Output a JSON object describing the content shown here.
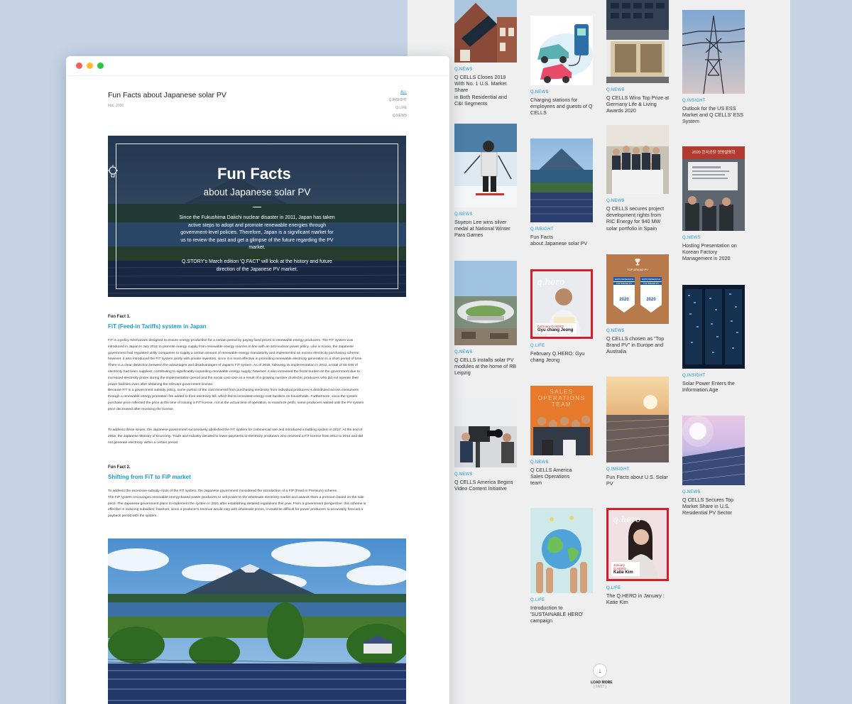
{
  "article": {
    "title": "Fun Facts about Japanese solar PV",
    "date": "Mar, 2020",
    "filters": [
      "ALL",
      "Q.INSIGHT",
      "Q.LIFE",
      "Q.NEWS"
    ],
    "hero": {
      "title": "Fun Facts",
      "subtitle": "about Japanese solar PV",
      "intro": "Since the Fukushima Daiichi nuclear disaster in 2011, Japan has taken active steps to adopt and promote renewable energies through government-level policies. Therefore, Japan is a significant market for us to review the past and get a glimpse of the future regarding the PV market.",
      "intro2": "Q.STORY's March edition 'Q.FACT' will look at the history and future direction of the Japanese PV market."
    },
    "fact1": {
      "label": "Fun Fact 1.",
      "heading": "FiT (Feed-in Tariffs) system in Japan",
      "p1": "FiT is a policy mechanism designed to ensure energy production for a certain period by paying fixed prices to renewable energy producers. The FiT system was\nintroduced in Japan in July 2012 to promote energy supply from renewable energy sources in line with an anti-nuclear power policy. Like in Korea, the Japanese\ngovernment had regulated utility companies to supply a certain amount of renewable energy mandatorily and implemented an excess electricity purchasing scheme;\nhowever, it also introduced the FiT system jointly with private investors, since it is most effective in promoting renewable electricity generation in a short period of time.\nThere is a clear distinction between the advantages and disadvantages of Japan's FiT system. As of 2018, following its implementation in 2012, a total of 56 GW of\nelectricity had been supplied, contributing to significantly expanding renewable energy supply; however, it also increased the fiscal burden on the government due to\nincreased electricity prices during the implementation period and the social cost rose as a result of a growing number of electric producers who did not operate their\npower facilities even after obtaining the relevant government license.\nBecause FiT is a government subsidy policy, some portion of the cost incurred from purchasing electricity from individual producers is distributed across consumers\nthrough a renewable energy promotion fee added to their electricity bill, which led to increased energy-cost burdens on households. Furthermore, since the system\npurchase price reflected the price at the time of issuing a FiT license, not at the actual time of operation, to maximize profit, some producers waited until the PV system\nprice decreased after receiving the license.",
      "p2": "To address these issues, the Japanese government successively abolished the FiT system for commercial use and introduced a bidding system in 2017. At the end of\n2018, the Japanese Ministry of Economy, Trade and Industry decided to lower payments to electricity producers who received a FiT license from 2012 to 2014 and did\nnot generate electricity within a certain period."
    },
    "fact2": {
      "label": "Fun Fact 2.",
      "heading": "Shifting from FiT to FiP market",
      "p1": "To address the excessive subsidy costs of the FiT system, the Japanese government considered the introduction of a FiP (Feed in Premium) scheme.\nThe FiP system encourages renewable energy-based power producers to sell power to the wholesale electricity market and awards them a premium based on the sale\nprice. The Japanese government plans to implement the system in 2021 after establishing detailed regulations this year. From a government perspective, this scheme is\neffective in reducing subsidies; however, since a producer's revenue would vary with wholesale prices, it would be difficult for power producers to accurately forecast a\npayback period with the system."
    }
  },
  "grid": {
    "col1": [
      {
        "tag": "Q.NEWS",
        "title": "Q CELLS Closes 2019\nWith No. 1 U.S. Market\nShare\nin Both Residential and\nC&I Segments"
      },
      {
        "tag": "Q.NEWS",
        "title": "Suyeon Lee wins silver\nmedal at National Winter\nPara Games"
      },
      {
        "tag": "Q.NEWS",
        "title": "Q CELLS installs solar PV\nmodules at the home of RB\nLeipzig"
      },
      {
        "tag": "Q.NEWS",
        "title": "Q CELLS America Begins\nVideo Content Initiative"
      }
    ],
    "col2": [
      {
        "tag": "Q.NEWS",
        "title": "Charging stations for\nemployees and guests of Q\nCELLS"
      },
      {
        "tag": "Q.INSIGHT",
        "title": "Fun Facts\nabout Japanese solar PV"
      },
      {
        "tag": "Q.LIFE",
        "title": "February Q.HERO: Gyu\nchang Jeong",
        "badge_month": "February Q.HERO",
        "badge_name": "Gyu chang Jeong",
        "script": "q.hero"
      },
      {
        "tag": "Q.NEWS",
        "title": "Q CELLS America\nSales Operations\nteam",
        "banner": "SALES\nOPERATIONS\nTEAM"
      },
      {
        "tag": "Q.LIFE",
        "title": "Introduction to\n'SUSTAINABLE HERO'\ncampaign"
      }
    ],
    "col3": [
      {
        "tag": "Q.NEWS",
        "title": "Q CELLS Wins Top Prize at\nGermany Life & Living\nAwards 2020"
      },
      {
        "tag": "Q.NEWS",
        "title": "Q CELLS secures project\ndevelopment rights from\nRIC Energy for 940 MW\nsolar portfolio in Spain"
      },
      {
        "tag": "Q.NEWS",
        "title": "Q CELLS chosen as \"Top\nBrand PV\" in Europe and\nAustralia",
        "award_top": "TOP BRAND PV",
        "award_org": "EUPD RESEARCH",
        "award_text": "TOP BRAND PV",
        "award_year": "2020"
      },
      {
        "tag": "Q.INSIGHT",
        "title": "Fun Facts about U.S. Solar\nPV"
      },
      {
        "tag": "Q.LIFE",
        "title": "The Q.HERO in January :\nKatie Kim",
        "badge_month": "January\nQ.HERO",
        "badge_name": "Katie Kim",
        "script": "q.hero"
      }
    ],
    "col4": [
      {
        "tag": "Q.INSIGHT",
        "title": "Outlook for the US ESS\nMarket and Q CELLS' ESS\nSystem"
      },
      {
        "tag": "Q.NEWS",
        "title": "Hosting Presentation on\nKorean Factory\nManagement in 2020",
        "sign": "2020 한국공장 경영설명회"
      },
      {
        "tag": "Q.INSIGHT",
        "title": "Solar Power Enters the\nInformation Age"
      },
      {
        "tag": "Q.NEWS",
        "title": "Q CELLS Secures Top\nMarket Share in U.S.\nResidential PV Sector"
      }
    ]
  },
  "loadmore": {
    "label": "LOAD MORE",
    "count": "( 24/27 )",
    "icon": "arrow-down-icon"
  }
}
